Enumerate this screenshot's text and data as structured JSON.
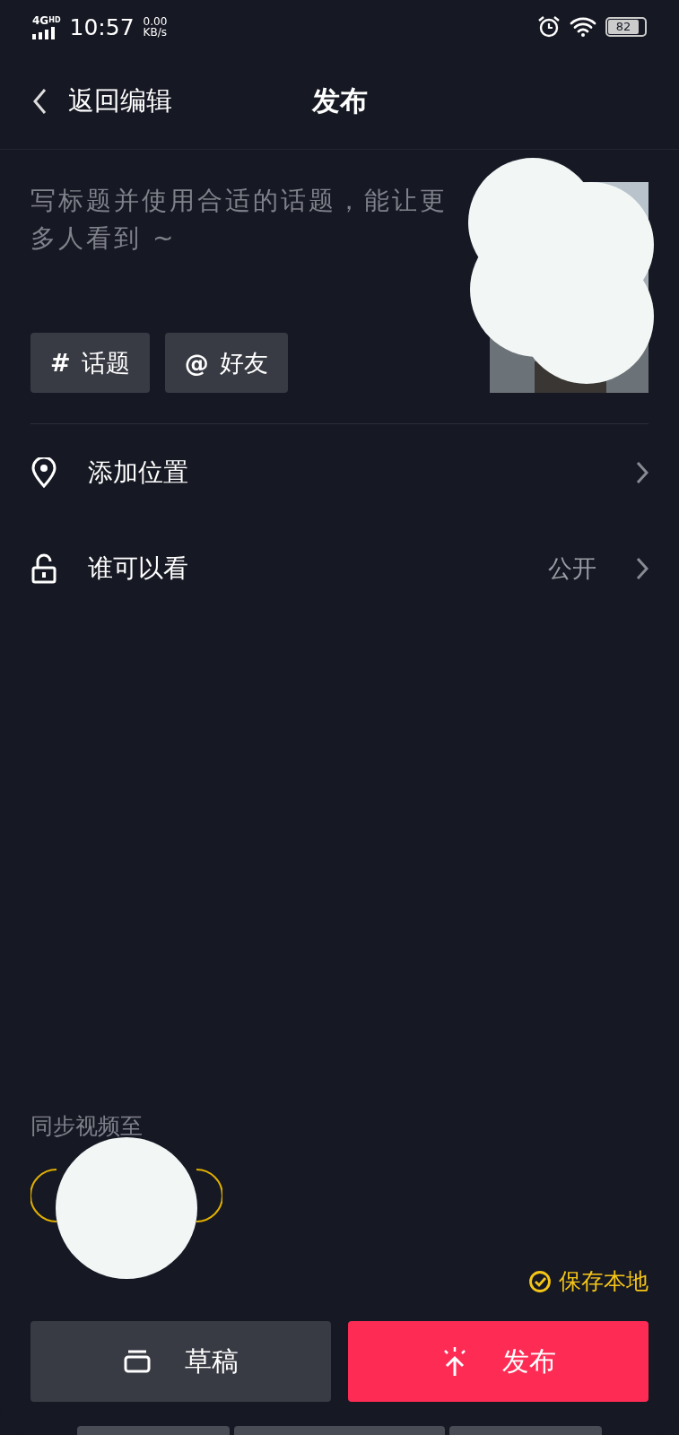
{
  "status_bar": {
    "network": "4G",
    "network_sup": "HD",
    "time": "10:57",
    "speed_value": "0.00",
    "speed_unit": "KB/s",
    "battery": "82"
  },
  "header": {
    "back_label": "返回编辑",
    "title": "发布"
  },
  "caption": {
    "placeholder": "写标题并使用合适的话题，能让更多人看到 ~"
  },
  "chips": [
    {
      "icon": "#",
      "label": "话题"
    },
    {
      "icon": "@",
      "label": "好友"
    }
  ],
  "settings": [
    {
      "kind": "location",
      "label": "添加位置"
    },
    {
      "kind": "privacy",
      "label": "谁可以看",
      "value": "公开"
    }
  ],
  "sync": {
    "label": "同步视频至"
  },
  "save_local": {
    "label": "保存本地",
    "checked": true
  },
  "actions": [
    {
      "kind": "draft",
      "label": "草稿"
    },
    {
      "kind": "publish",
      "label": "发布"
    }
  ]
}
